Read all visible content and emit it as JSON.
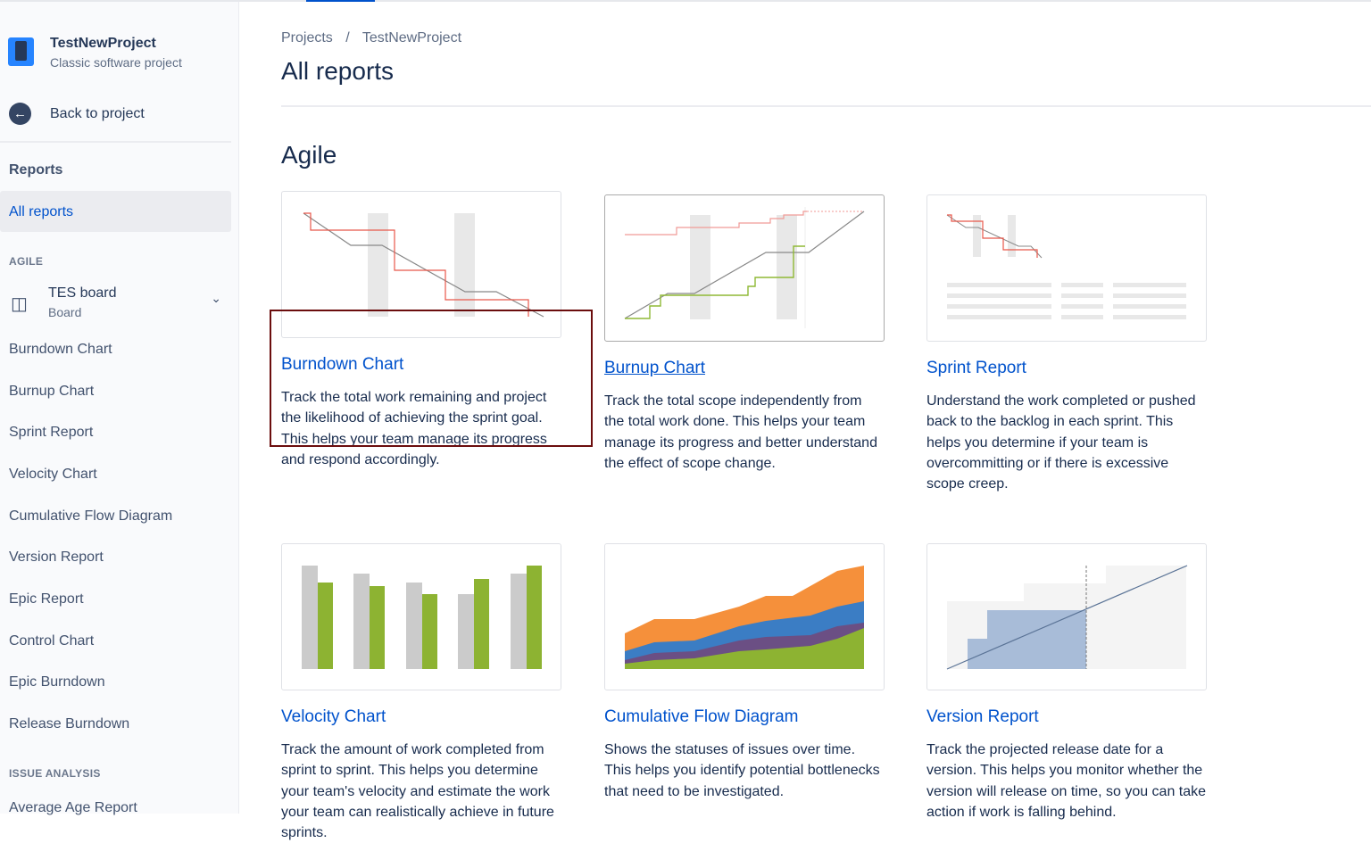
{
  "project": {
    "name": "TestNewProject",
    "type": "Classic software project"
  },
  "sidebar": {
    "back_label": "Back to project",
    "reports_heading": "Reports",
    "active_item": "All reports",
    "agile_group": "AGILE",
    "board": {
      "name": "TES board",
      "sub": "Board"
    },
    "items": [
      "Burndown Chart",
      "Burnup Chart",
      "Sprint Report",
      "Velocity Chart",
      "Cumulative Flow Diagram",
      "Version Report",
      "Epic Report",
      "Control Chart",
      "Epic Burndown",
      "Release Burndown"
    ],
    "issue_group": "ISSUE ANALYSIS",
    "issue_items": [
      "Average Age Report"
    ]
  },
  "breadcrumb": [
    "Projects",
    "/",
    "TestNewProject"
  ],
  "page_title": "All reports",
  "section_title": "Agile",
  "cards": [
    {
      "title": "Burndown Chart",
      "desc": "Track the total work remaining and project the likelihood of achieving the sprint goal. This helps your team manage its progress and respond accordingly."
    },
    {
      "title": "Burnup Chart",
      "desc": "Track the total scope independently from the total work done. This helps your team manage its progress and better understand the effect of scope change."
    },
    {
      "title": "Sprint Report",
      "desc": "Understand the work completed or pushed back to the backlog in each sprint. This helps you determine if your team is overcommitting or if there is excessive scope creep."
    },
    {
      "title": "Velocity Chart",
      "desc": "Track the amount of work completed from sprint to sprint. This helps you determine your team's velocity and estimate the work your team can realistically achieve in future sprints."
    },
    {
      "title": "Cumulative Flow Diagram",
      "desc": "Shows the statuses of issues over time. This helps you identify potential bottlenecks that need to be investigated."
    },
    {
      "title": "Version Report",
      "desc": "Track the projected release date for a version. This helps you monitor whether the version will release on time, so you can take action if work is falling behind."
    }
  ]
}
